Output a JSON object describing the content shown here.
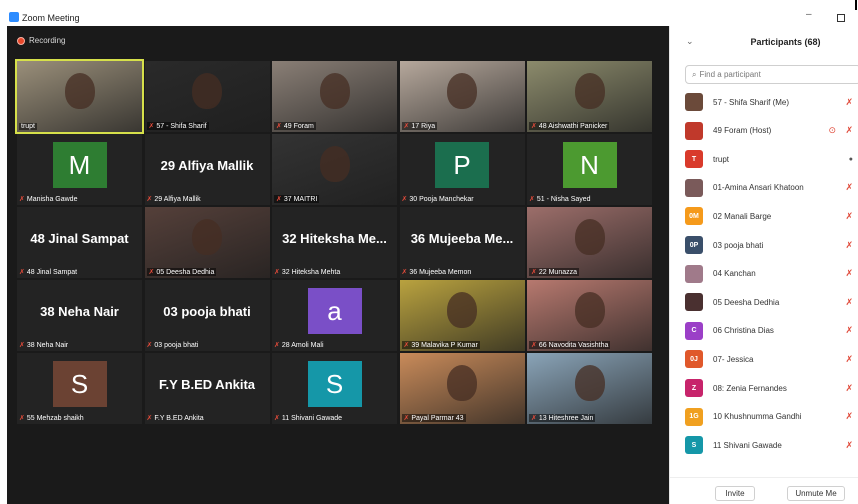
{
  "window": {
    "title": "Zoom Meeting",
    "minimize": "–",
    "maximize": ""
  },
  "meeting": {
    "recording_label": "Recording",
    "tiles": [
      {
        "label": "trupt",
        "kind": "photo",
        "bg": "#9a8f7a",
        "active": true,
        "muted": false
      },
      {
        "label": "57 - Shifa Sharif",
        "kind": "photo",
        "bg": "#2a2a2a",
        "muted": true
      },
      {
        "label": "49 Foram",
        "kind": "photo",
        "bg": "#8a7f76",
        "muted": true
      },
      {
        "label": "17 Riya",
        "kind": "photo",
        "bg": "#b6a89c",
        "muted": true
      },
      {
        "label": "48 Aishwathi Panicker",
        "kind": "photo",
        "bg": "#8c8b6c",
        "muted": true
      },
      {
        "label": "Manisha Gawde",
        "kind": "avatar",
        "letter": "M",
        "color": "#2e7d32",
        "muted": true
      },
      {
        "label": "29 Alfiya Mallik",
        "kind": "text",
        "big": "29 Alfiya Mallik",
        "muted": true
      },
      {
        "label": "37 MAITRI",
        "kind": "photo",
        "bg": "#333333",
        "muted": true
      },
      {
        "label": "30 Pooja Manchekar",
        "kind": "avatar",
        "letter": "P",
        "color": "#1b6e4e",
        "muted": true
      },
      {
        "label": "51 - Nisha Sayed",
        "kind": "avatar",
        "letter": "N",
        "color": "#4c9a30",
        "muted": true
      },
      {
        "label": "48 Jinal Sampat",
        "kind": "text",
        "big": "48 Jinal Sampat",
        "muted": true
      },
      {
        "label": "05 Deesha Dedhia",
        "kind": "photo",
        "bg": "#55403a",
        "muted": true
      },
      {
        "label": "32 Hiteksha Mehta",
        "kind": "text",
        "big": "32 Hiteksha Me...",
        "muted": true
      },
      {
        "label": "36 Mujeeba Memon",
        "kind": "text",
        "big": "36 Mujeeba Me...",
        "muted": true
      },
      {
        "label": "22 Munazza",
        "kind": "photo",
        "bg": "#9c6e6a",
        "muted": true
      },
      {
        "label": "38 Neha Nair",
        "kind": "text",
        "big": "38 Neha Nair",
        "muted": true
      },
      {
        "label": "03 pooja bhati",
        "kind": "text",
        "big": "03 pooja bhati",
        "muted": true
      },
      {
        "label": "28 Amoli Mali",
        "kind": "avatar",
        "letter": "a",
        "color": "#7a4fc7",
        "muted": true
      },
      {
        "label": "39 Malavika P Kumar",
        "kind": "photo",
        "bg": "#b9a23f",
        "muted": true
      },
      {
        "label": "66 Navodita Vasishtha",
        "kind": "photo",
        "bg": "#b7796f",
        "muted": true
      },
      {
        "label": "55 Mehzab shaikh",
        "kind": "avatar",
        "letter": "S",
        "color": "#6b4233",
        "muted": true
      },
      {
        "label": "F.Y B.ED Ankita",
        "kind": "text",
        "big": "F.Y B.ED Ankita",
        "muted": true
      },
      {
        "label": "11 Shivani Gawade",
        "kind": "avatar",
        "letter": "S",
        "color": "#1597a8",
        "muted": true
      },
      {
        "label": "Payal Parmar 43",
        "kind": "photo",
        "bg": "#c98b5a",
        "muted": true
      },
      {
        "label": "13 Hiteshree Jain",
        "kind": "photo",
        "bg": "#8aa4b8",
        "muted": true
      }
    ]
  },
  "participants_panel": {
    "title": "Participants (68)",
    "search_placeholder": "Find a participant",
    "invite_label": "Invite",
    "unmute_me_label": "Unmute Me",
    "items": [
      {
        "name": "57 - Shifa Sharif (Me)",
        "avatar": "",
        "color": "#6b4a3a",
        "mic": "muted"
      },
      {
        "name": "49 Foram (Host)",
        "avatar": "",
        "color": "#c0392b",
        "mic": "muted",
        "video_off": true
      },
      {
        "name": "trupt",
        "avatar": "T",
        "color": "#d93a2b",
        "mic": "live"
      },
      {
        "name": "01-Amina Ansari Khatoon",
        "avatar": "",
        "color": "#7a5a5a",
        "mic": "muted"
      },
      {
        "name": "02 Manali Barge",
        "avatar": "0M",
        "color": "#f59a1b",
        "mic": "muted"
      },
      {
        "name": "03 pooja bhati",
        "avatar": "0P",
        "color": "#3a4f6a",
        "mic": "muted"
      },
      {
        "name": "04 Kanchan",
        "avatar": "",
        "color": "#a07a8a",
        "mic": "muted"
      },
      {
        "name": "05 Deesha Dedhia",
        "avatar": "",
        "color": "#4a3030",
        "mic": "muted"
      },
      {
        "name": "06 Christina Dias",
        "avatar": "C",
        "color": "#9b3fc7",
        "mic": "muted"
      },
      {
        "name": "07- Jessica",
        "avatar": "0J",
        "color": "#e0582b",
        "mic": "muted"
      },
      {
        "name": "08: Zenia Fernandes",
        "avatar": "Z",
        "color": "#c7246b",
        "mic": "muted"
      },
      {
        "name": "10 Khushnumma Gandhi",
        "avatar": "1G",
        "color": "#f0a020",
        "mic": "muted"
      },
      {
        "name": "11 Shivani Gawade",
        "avatar": "S",
        "color": "#1597a8",
        "mic": "muted"
      }
    ]
  }
}
